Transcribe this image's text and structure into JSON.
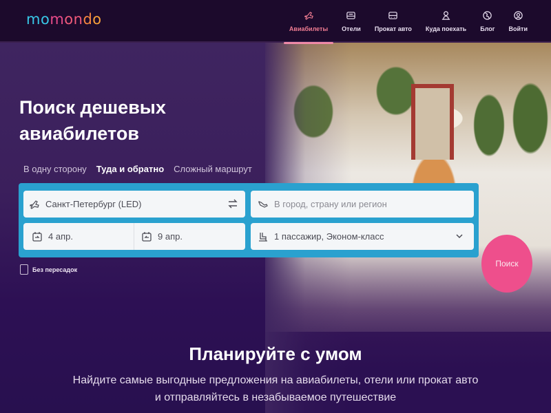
{
  "brand": {
    "logo_parts": [
      "mo",
      "m",
      "o",
      "n",
      "d",
      "o"
    ],
    "colors": {
      "accent_pink": "#ee4f8c",
      "panel_blue": "#2aa1cf",
      "nav_active": "#ef7c92",
      "background": "#2a0f4a"
    }
  },
  "nav": {
    "items": [
      {
        "label": "Авиабилеты",
        "icon": "plane-icon",
        "active": true
      },
      {
        "label": "Отели",
        "icon": "bed-icon",
        "active": false
      },
      {
        "label": "Прокат авто",
        "icon": "car-icon",
        "active": false
      },
      {
        "label": "Куда поехать",
        "icon": "person-icon",
        "active": false
      },
      {
        "label": "Блог",
        "icon": "globe-icon",
        "active": false
      },
      {
        "label": "Войти",
        "icon": "user-icon",
        "active": false
      }
    ]
  },
  "hero": {
    "title": "Поиск дешевых авиабилетов",
    "trip_tabs": [
      {
        "label": "В одну сторону",
        "active": false
      },
      {
        "label": "Туда и обратно",
        "active": true
      },
      {
        "label": "Сложный маршрут",
        "active": false
      }
    ]
  },
  "search": {
    "origin_value": "Санкт-Петербург (LED)",
    "destination_placeholder": "В город, страну или регион",
    "depart_date": "4 апр.",
    "return_date": "9 апр.",
    "passengers": "1 пассажир, Эконом-класс",
    "search_label": "Поиск",
    "nonstop_label": "Без пересадок",
    "nonstop_checked": false
  },
  "section": {
    "title": "Планируйте с умом",
    "subtitle": "Найдите самые выгодные предложения на авиабилеты, отели или прокат авто и отправляйтесь в незабываемое путешествие"
  }
}
